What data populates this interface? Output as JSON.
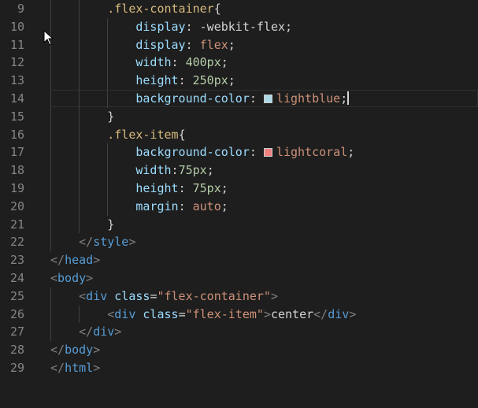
{
  "editor": {
    "theme_colors": {
      "background": "#1e1e1e",
      "line_number": "#858585",
      "selector": "#d7ba7d",
      "property": "#9cdcfe",
      "value": "#ce9178",
      "number": "#b5cea8",
      "tag": "#569cd6",
      "bracket": "#808080"
    },
    "current_line": 14,
    "swatch_colors": {
      "lightblue": "#add8e6",
      "lightcoral": "#f08080"
    },
    "lines": [
      {
        "n": "9",
        "indent": "        ",
        "tokens": [
          {
            "t": ".flex-container",
            "c": "sel"
          },
          {
            "t": "{",
            "c": "punc"
          }
        ]
      },
      {
        "n": "10",
        "indent": "            ",
        "tokens": [
          {
            "t": "display",
            "c": "prop"
          },
          {
            "t": ": ",
            "c": "punc"
          },
          {
            "t": "-webkit-flex",
            "c": "punc"
          },
          {
            "t": ";",
            "c": "punc"
          }
        ]
      },
      {
        "n": "11",
        "indent": "            ",
        "tokens": [
          {
            "t": "display",
            "c": "prop"
          },
          {
            "t": ": ",
            "c": "punc"
          },
          {
            "t": "flex",
            "c": "val"
          },
          {
            "t": ";",
            "c": "punc"
          }
        ]
      },
      {
        "n": "12",
        "indent": "            ",
        "tokens": [
          {
            "t": "width",
            "c": "prop"
          },
          {
            "t": ": ",
            "c": "punc"
          },
          {
            "t": "400px",
            "c": "num"
          },
          {
            "t": ";",
            "c": "punc"
          }
        ]
      },
      {
        "n": "13",
        "indent": "            ",
        "tokens": [
          {
            "t": "height",
            "c": "prop"
          },
          {
            "t": ": ",
            "c": "punc"
          },
          {
            "t": "250px",
            "c": "num"
          },
          {
            "t": ";",
            "c": "punc"
          }
        ]
      },
      {
        "n": "14",
        "indent": "            ",
        "tokens": [
          {
            "t": "background-color",
            "c": "prop"
          },
          {
            "t": ": ",
            "c": "punc"
          },
          {
            "t": "",
            "c": "swatch",
            "color": "lightblue"
          },
          {
            "t": "lightblue",
            "c": "val"
          },
          {
            "t": ";",
            "c": "punc"
          },
          {
            "t": "",
            "c": "cursor"
          }
        ]
      },
      {
        "n": "15",
        "indent": "        ",
        "tokens": [
          {
            "t": "}",
            "c": "punc"
          }
        ]
      },
      {
        "n": "16",
        "indent": "        ",
        "tokens": [
          {
            "t": ".flex-item",
            "c": "sel"
          },
          {
            "t": "{",
            "c": "punc"
          }
        ]
      },
      {
        "n": "17",
        "indent": "            ",
        "tokens": [
          {
            "t": "background-color",
            "c": "prop"
          },
          {
            "t": ": ",
            "c": "punc"
          },
          {
            "t": "",
            "c": "swatch",
            "color": "lightcoral"
          },
          {
            "t": "lightcoral",
            "c": "val"
          },
          {
            "t": ";",
            "c": "punc"
          }
        ]
      },
      {
        "n": "18",
        "indent": "            ",
        "tokens": [
          {
            "t": "width",
            "c": "prop"
          },
          {
            "t": ":",
            "c": "punc"
          },
          {
            "t": "75px",
            "c": "num"
          },
          {
            "t": ";",
            "c": "punc"
          }
        ]
      },
      {
        "n": "19",
        "indent": "            ",
        "tokens": [
          {
            "t": "height",
            "c": "prop"
          },
          {
            "t": ": ",
            "c": "punc"
          },
          {
            "t": "75px",
            "c": "num"
          },
          {
            "t": ";",
            "c": "punc"
          }
        ]
      },
      {
        "n": "20",
        "indent": "            ",
        "tokens": [
          {
            "t": "margin",
            "c": "prop"
          },
          {
            "t": ": ",
            "c": "punc"
          },
          {
            "t": "auto",
            "c": "val"
          },
          {
            "t": ";",
            "c": "punc"
          }
        ]
      },
      {
        "n": "21",
        "indent": "        ",
        "tokens": [
          {
            "t": "}",
            "c": "punc"
          }
        ]
      },
      {
        "n": "22",
        "indent": "    ",
        "tokens": [
          {
            "t": "</",
            "c": "br"
          },
          {
            "t": "style",
            "c": "tag"
          },
          {
            "t": ">",
            "c": "br"
          }
        ]
      },
      {
        "n": "23",
        "indent": "",
        "tokens": [
          {
            "t": "</",
            "c": "br"
          },
          {
            "t": "head",
            "c": "tag"
          },
          {
            "t": ">",
            "c": "br"
          }
        ]
      },
      {
        "n": "24",
        "indent": "",
        "tokens": [
          {
            "t": "<",
            "c": "br"
          },
          {
            "t": "body",
            "c": "tag"
          },
          {
            "t": ">",
            "c": "br"
          }
        ]
      },
      {
        "n": "25",
        "indent": "    ",
        "tokens": [
          {
            "t": "<",
            "c": "br"
          },
          {
            "t": "div",
            "c": "tag"
          },
          {
            "t": " ",
            "c": "punc"
          },
          {
            "t": "class",
            "c": "attr"
          },
          {
            "t": "=",
            "c": "punc"
          },
          {
            "t": "\"flex-container\"",
            "c": "str"
          },
          {
            "t": ">",
            "c": "br"
          }
        ]
      },
      {
        "n": "26",
        "indent": "        ",
        "tokens": [
          {
            "t": "<",
            "c": "br"
          },
          {
            "t": "div",
            "c": "tag"
          },
          {
            "t": " ",
            "c": "punc"
          },
          {
            "t": "class",
            "c": "attr"
          },
          {
            "t": "=",
            "c": "punc"
          },
          {
            "t": "\"flex-item\"",
            "c": "str"
          },
          {
            "t": ">",
            "c": "br"
          },
          {
            "t": "center",
            "c": "text"
          },
          {
            "t": "</",
            "c": "br"
          },
          {
            "t": "div",
            "c": "tag"
          },
          {
            "t": ">",
            "c": "br"
          }
        ]
      },
      {
        "n": "27",
        "indent": "    ",
        "tokens": [
          {
            "t": "</",
            "c": "br"
          },
          {
            "t": "div",
            "c": "tag"
          },
          {
            "t": ">",
            "c": "br"
          }
        ]
      },
      {
        "n": "28",
        "indent": "",
        "tokens": [
          {
            "t": "</",
            "c": "br"
          },
          {
            "t": "body",
            "c": "tag"
          },
          {
            "t": ">",
            "c": "br"
          }
        ]
      },
      {
        "n": "29",
        "indent": "",
        "tokens": [
          {
            "t": "</",
            "c": "br"
          },
          {
            "t": "html",
            "c": "tag"
          },
          {
            "t": ">",
            "c": "br"
          }
        ]
      }
    ],
    "mouse_pointer_icon": "arrow-cursor"
  }
}
